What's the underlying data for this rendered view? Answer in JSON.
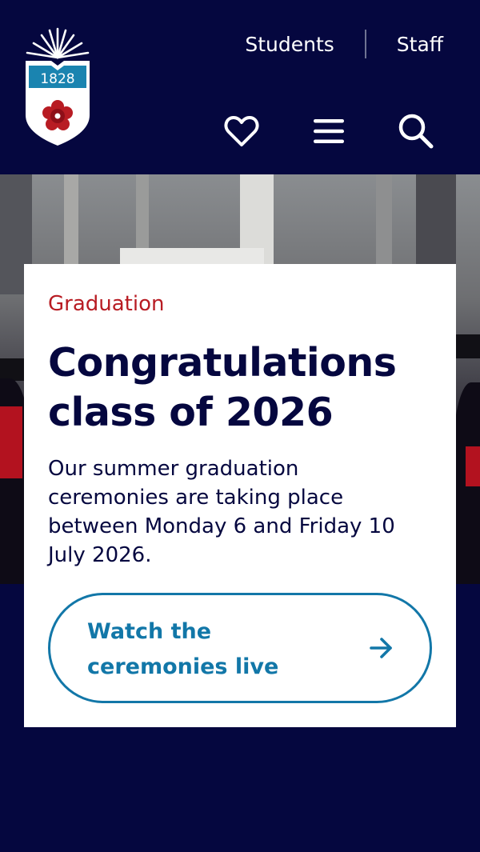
{
  "header": {
    "logo_year": "1828",
    "utility_nav": [
      {
        "label": "Students"
      },
      {
        "label": "Staff"
      }
    ],
    "icons": {
      "favourites": "heart-icon",
      "menu": "hamburger-menu-icon",
      "search": "search-icon"
    }
  },
  "hero_card": {
    "eyebrow": "Graduation",
    "title": "Congratulations class of 2026",
    "body": "Our summer graduation ceremonies are taking place between Monday 6 and Friday 10 July 2026.",
    "cta_label": "Watch the ceremonies live",
    "cta_icon": "arrow-right-icon"
  },
  "colors": {
    "navy": "#05073f",
    "red": "#b81c23",
    "teal": "#1277a8",
    "white": "#ffffff"
  }
}
